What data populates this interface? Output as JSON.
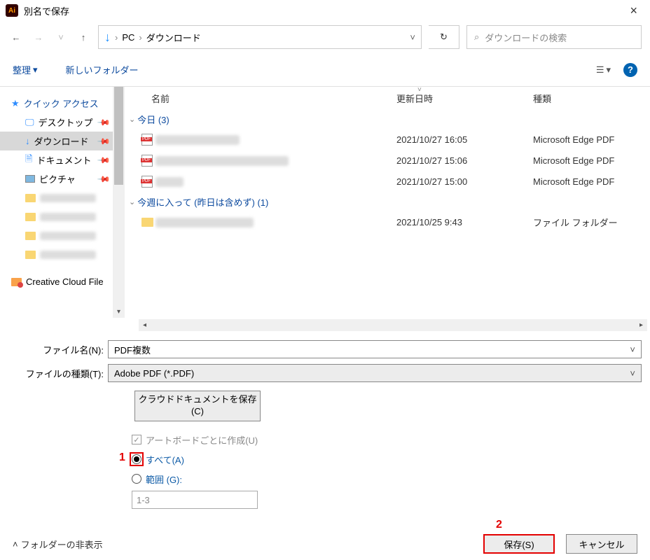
{
  "title": "別名で保存",
  "breadcrumb": {
    "pc": "PC",
    "folder": "ダウンロード"
  },
  "search_placeholder": "ダウンロードの検索",
  "toolbar": {
    "organize": "整理",
    "new_folder": "新しいフォルダー"
  },
  "sidebar": {
    "quick_access": "クイック アクセス",
    "desktop": "デスクトップ",
    "downloads": "ダウンロード",
    "documents": "ドキュメント",
    "pictures": "ピクチャ",
    "cc": "Creative Cloud File"
  },
  "columns": {
    "name": "名前",
    "date": "更新日時",
    "kind": "種類"
  },
  "groups": {
    "today": "今日 (3)",
    "week": "今週に入って (昨日は含めず) (1)"
  },
  "rows": [
    {
      "date": "2021/10/27 16:05",
      "kind": "Microsoft Edge PDF"
    },
    {
      "date": "2021/10/27 15:06",
      "kind": "Microsoft Edge PDF"
    },
    {
      "date": "2021/10/27 15:00",
      "kind": "Microsoft Edge PDF"
    }
  ],
  "rows2": [
    {
      "date": "2021/10/25 9:43",
      "kind": "ファイル フォルダー"
    }
  ],
  "labels": {
    "filename": "ファイル名(N):",
    "filetype": "ファイルの種類(T):",
    "cloud": "クラウドドキュメントを保存(C)",
    "artboard": "アートボードごとに作成(U)",
    "all": "すべて(A)",
    "range": "範囲 (G):",
    "range_value": "1-3",
    "hide_folders": "フォルダーの非表示",
    "save": "保存(S)",
    "cancel": "キャンセル"
  },
  "filename_value": "PDF複数",
  "filetype_value": "Adobe PDF (*.PDF)",
  "callouts": {
    "one": "1",
    "two": "2"
  }
}
